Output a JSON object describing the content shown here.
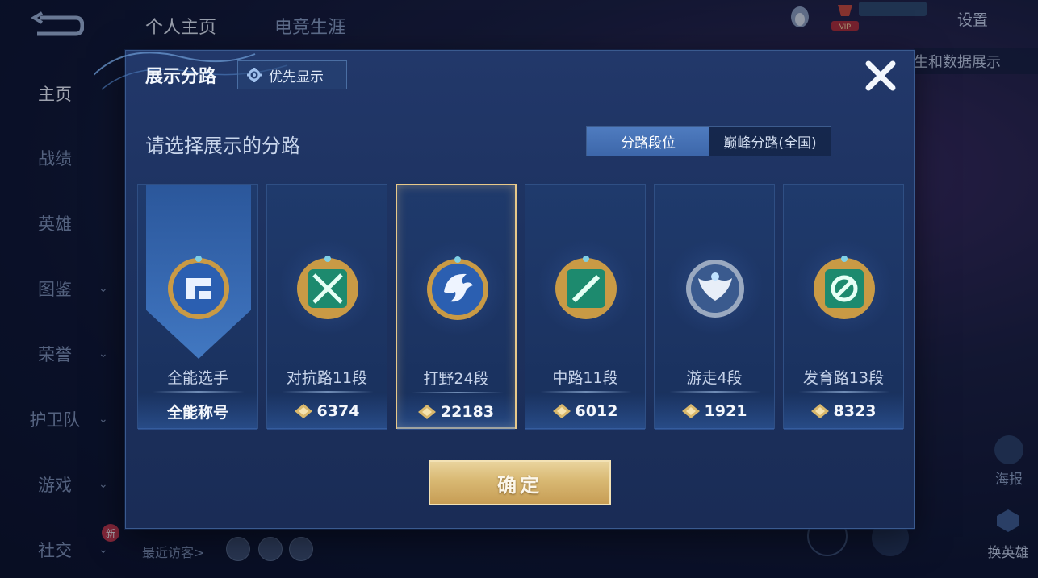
{
  "top_nav": {
    "tabs": [
      "个人主页",
      "电竞生涯"
    ],
    "settings_label": "设置",
    "vip_label": "VIP",
    "right_banner": "生和数据展示"
  },
  "sidebar": {
    "items": [
      {
        "label": "主页",
        "active": true,
        "chevron": false
      },
      {
        "label": "战绩",
        "active": false,
        "chevron": false
      },
      {
        "label": "英雄",
        "active": false,
        "chevron": false
      },
      {
        "label": "图鉴",
        "active": false,
        "chevron": true
      },
      {
        "label": "荣誉",
        "active": false,
        "chevron": true
      },
      {
        "label": "护卫队",
        "active": false,
        "chevron": true
      },
      {
        "label": "游戏",
        "active": false,
        "chevron": true
      },
      {
        "label": "社交",
        "active": false,
        "chevron": true
      }
    ],
    "new_badge": "新"
  },
  "bottom": {
    "recent_visitors": "最近访客>",
    "poster": "海报",
    "swap_hero": "换英雄"
  },
  "modal": {
    "title": "展示分路",
    "priority_label": "优先显示",
    "subtitle": "请选择展示的分路",
    "segments": [
      "分路段位",
      "巅峰分路(全国)"
    ],
    "cards": [
      {
        "name": "全能选手",
        "bottom": "全能称号",
        "score": null,
        "selected": false,
        "ribbon": true,
        "badge": "allround-badge-icon"
      },
      {
        "name": "对抗路11段",
        "bottom": null,
        "score": "6374",
        "selected": false,
        "ribbon": false,
        "badge": "clash-lane-badge-icon"
      },
      {
        "name": "打野24段",
        "bottom": null,
        "score": "22183",
        "selected": true,
        "ribbon": false,
        "badge": "jungle-badge-icon"
      },
      {
        "name": "中路11段",
        "bottom": null,
        "score": "6012",
        "selected": false,
        "ribbon": false,
        "badge": "mid-lane-badge-icon"
      },
      {
        "name": "游走4段",
        "bottom": null,
        "score": "1921",
        "selected": false,
        "ribbon": false,
        "badge": "roam-badge-icon"
      },
      {
        "name": "发育路13段",
        "bottom": null,
        "score": "8323",
        "selected": false,
        "ribbon": false,
        "badge": "farm-lane-badge-icon"
      }
    ],
    "confirm_label": "确定"
  },
  "colors": {
    "accent_gold": "#e8c98a",
    "segment_active": "#4f7cc0",
    "modal_bg": "#1d3260"
  }
}
